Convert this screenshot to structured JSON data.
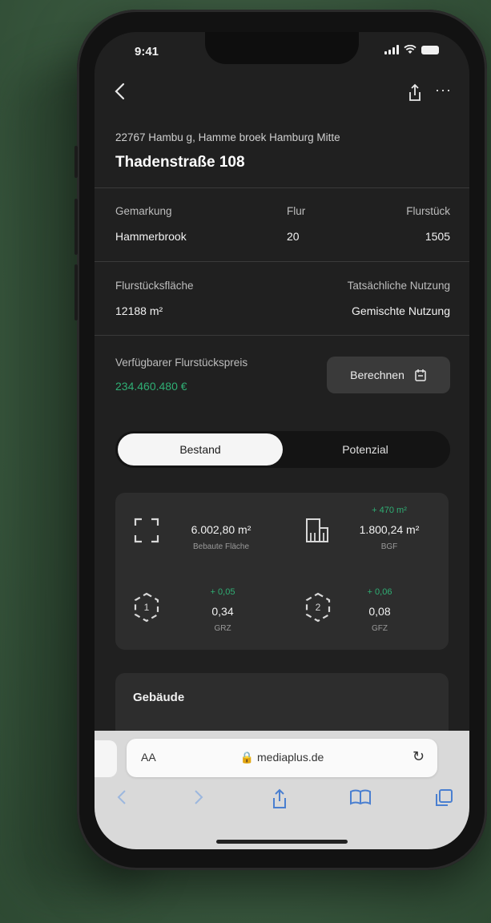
{
  "status": {
    "time": "9:41"
  },
  "nav": {
    "back_icon": "chevron-left-icon",
    "share_icon": "share-icon",
    "more_label": "···"
  },
  "header": {
    "address": "22767 Hambu g, Hamme broek Hamburg Mitte",
    "street": "Thadenstraße 108"
  },
  "parcel": {
    "gemarkung_label": "Gemarkung",
    "gemarkung_value": "Hammerbrook",
    "flur_label": "Flur",
    "flur_value": "20",
    "flurstueck_label": "Flurstück",
    "flurstueck_value": "1505"
  },
  "usage": {
    "area_label": "Flurstücksfläche",
    "area_value": "12188 m²",
    "actual_label": "Tatsächliche Nutzung",
    "actual_value": "Gemischte Nutzung"
  },
  "price": {
    "label": "Verfügbarer Flurstückspreis",
    "value": "234.460.480 €",
    "button_label": "Berechnen"
  },
  "tabs": {
    "active": "Bestand",
    "inactive": "Potenzial"
  },
  "stats": {
    "area_value": "6.002,80 m²",
    "area_label": "Bebaute Fläche",
    "bgf_delta": "+ 470 m²",
    "bgf_value": "1.800,24 m²",
    "bgf_label": "BGF",
    "grz_delta": "+ 0,05",
    "grz_value": "0,34",
    "grz_label": "GRZ",
    "gfz_delta": "+ 0,06",
    "gfz_value": "0,08",
    "gfz_label": "GFZ"
  },
  "building": {
    "title": "Gebäude"
  },
  "browser": {
    "aa_label": "AA",
    "url": "🔒 mediaplus.de",
    "reload_icon": "↻"
  }
}
